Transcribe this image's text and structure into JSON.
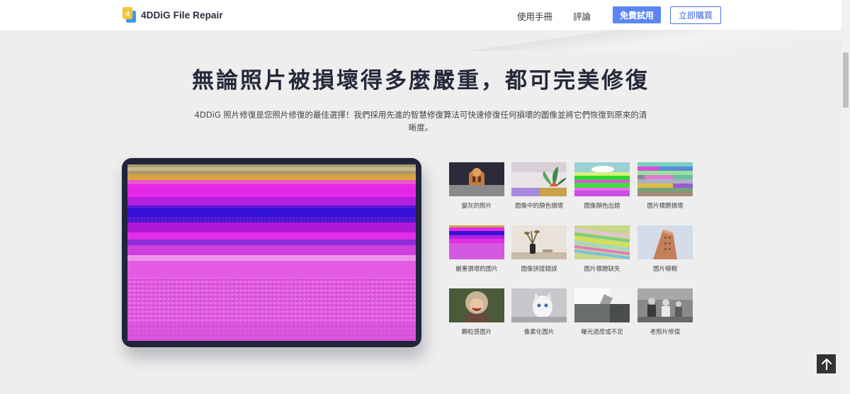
{
  "header": {
    "logo_text": "4DDiG File Repair",
    "nav": [
      {
        "label": "使用手冊"
      },
      {
        "label": "評論"
      }
    ],
    "free_trial_label": "免費試用",
    "buy_label": "立即購買"
  },
  "hero": {
    "title": "無論照片被損壞得多麼嚴重，都可完美修復",
    "description": "4DDiG 照片修復是您照片修復的最佳選擇！我們採用先進的智慧修復算法可快速修復任何損壞的圖像並將它們恢復到原來的清晰度。"
  },
  "thumbnails": [
    {
      "label": "變灰的照片",
      "theme": "gray-church"
    },
    {
      "label": "圖像中的顏色損壞",
      "theme": "succulent-color"
    },
    {
      "label": "圖像顏色出錯",
      "theme": "landscape-bands"
    },
    {
      "label": "圖片標題損壞",
      "theme": "noise-glitch"
    },
    {
      "label": "嚴重損壞的圖片",
      "theme": "purple-bands"
    },
    {
      "label": "圖像拼接錯誤",
      "theme": "vase-still-life"
    },
    {
      "label": "圖片標題缺失",
      "theme": "stripes-glitch"
    },
    {
      "label": "圖片模糊",
      "theme": "building-blur"
    },
    {
      "label": "顆粒感圖片",
      "theme": "laughing-child"
    },
    {
      "label": "像素化圖片",
      "theme": "cat"
    },
    {
      "label": "曝光過度或不足",
      "theme": "lamp-exposure"
    },
    {
      "label": "老照片修復",
      "theme": "old-family-photo"
    }
  ],
  "colors": {
    "primary": "#5b85f2",
    "buy_border": "#4a74e8",
    "title": "#25283a",
    "tablet_frame": "#22243a",
    "background": "#eeeeee"
  },
  "icons": {
    "back_to_top": "arrow-up-icon",
    "logo": "4ddig-logo-icon"
  }
}
